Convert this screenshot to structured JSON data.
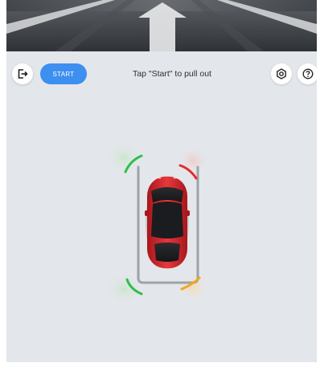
{
  "toolbar": {
    "start_label": "START",
    "status_text": "Tap \"Start\" to pull out"
  },
  "icons": {
    "exit": "exit-icon",
    "settings": "settings-icon",
    "help": "help-icon",
    "camera_arrow": "forward-arrow-icon",
    "car": "car-top-view-icon"
  },
  "sensors": [
    {
      "position": "front-left",
      "status": "clear",
      "color": "#2fbf4a"
    },
    {
      "position": "front-right",
      "status": "close",
      "color": "#e52b2b"
    },
    {
      "position": "rear-left",
      "status": "clear",
      "color": "#2fbf4a"
    },
    {
      "position": "rear-right",
      "status": "near",
      "color": "#f0a820"
    }
  ],
  "colors": {
    "accent": "#3d8ff0",
    "car_body": "#d8262a",
    "background": "#e3e6ea"
  }
}
